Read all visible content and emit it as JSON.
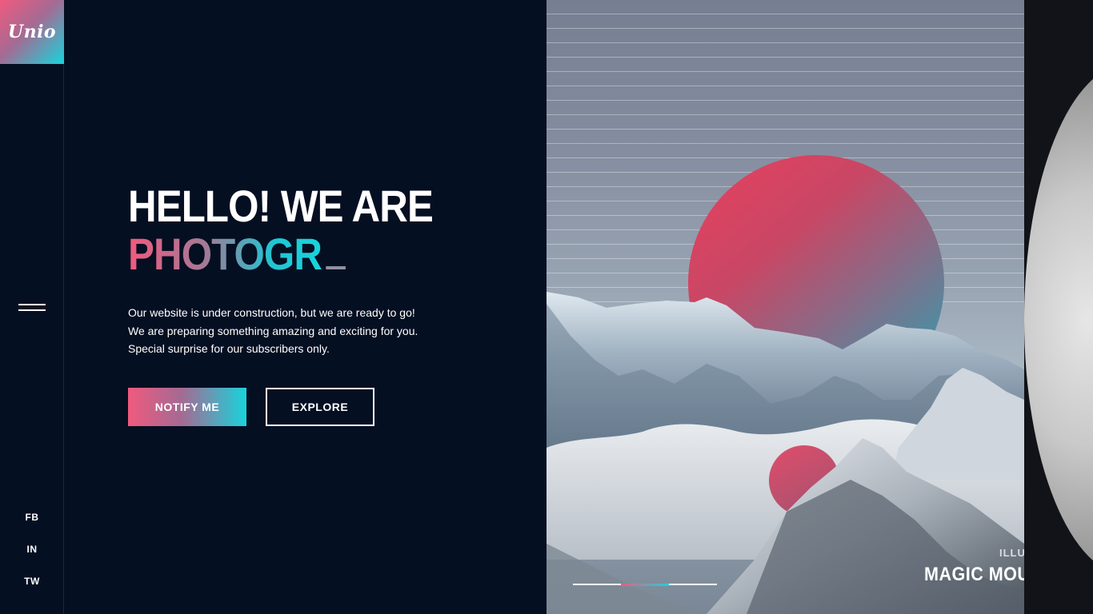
{
  "brand": {
    "logo_text": "Unio"
  },
  "sidebar": {
    "social": [
      {
        "label": "FB"
      },
      {
        "label": "IN"
      },
      {
        "label": "TW"
      }
    ]
  },
  "hero": {
    "title_line1": "HELLO! WE ARE",
    "title_line2": "PHOTOGR",
    "description": [
      "Our website is under construction, but we are ready to go!",
      "We are preparing something amazing and exciting for you.",
      "Special surprise for our subscribers only."
    ],
    "notify_label": "NOTIFY ME",
    "explore_label": "EXPLORE"
  },
  "slider": {
    "category": "ILLUS",
    "title": "MAGIC MOUI",
    "progress": {
      "active_index": 1,
      "total": 3
    }
  },
  "colors": {
    "background": "#050f22",
    "accent_pink": "#f05a7e",
    "accent_cyan": "#18d4dc"
  },
  "icons": {
    "menu": "hamburger-menu-icon"
  }
}
